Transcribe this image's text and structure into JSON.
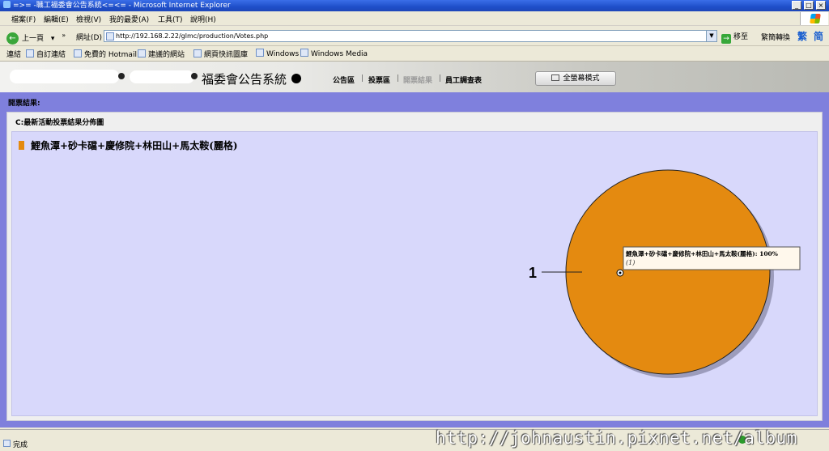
{
  "window": {
    "title": "=>=        -職工福委會公告系統<=<= - Microsoft Internet Explorer",
    "minimize": "_",
    "maximize": "□",
    "close": "×"
  },
  "menu": {
    "items": [
      "檔案(F)",
      "編輯(E)",
      "檢視(V)",
      "我的最愛(A)",
      "工具(T)",
      "說明(H)"
    ]
  },
  "toolbar": {
    "back_label": "上一頁",
    "back_dropdown": "▾",
    "more": "»",
    "address_label": "網址(D)",
    "address_value": "http://192.168.2.22/glmc/production/Votes.php",
    "go_label": "移至",
    "convert_label": "繁簡轉換",
    "trad_label": "繁",
    "simp_label": "简"
  },
  "links": {
    "label": "連結",
    "items": [
      "自訂連結",
      "免費的 Hotmail",
      "建議的網站",
      "網頁快訊圖庫",
      "Windows",
      "Windows Media"
    ]
  },
  "site": {
    "title": "福委會公告系統",
    "nav": [
      "公告區",
      "投票區",
      "開票結果",
      "員工調查表"
    ],
    "fullscreen_label": "全螢幕模式",
    "section_header": "開票結果:",
    "panel_title": "C:最新活動投票結果分佈圖"
  },
  "chart_data": {
    "type": "pie",
    "legend": [
      "鯉魚潭+砂卡礑+慶修院+林田山+馬太鞍(麗格)"
    ],
    "slices": [
      {
        "label": "鯉魚潭+砂卡礑+慶修院+林田山+馬太鞍(麗格)",
        "value": 1,
        "percent": "100%",
        "color": "#e48a10"
      }
    ],
    "callout_label": "1",
    "tooltip": {
      "label": "鯉魚潭+砂卡礑+慶修院+林田山+馬太鞍(麗格):",
      "percent": "100%",
      "count": "(1)"
    }
  },
  "status": {
    "text": "完成"
  },
  "watermark": "http://johnaustin.pixnet.net/album"
}
